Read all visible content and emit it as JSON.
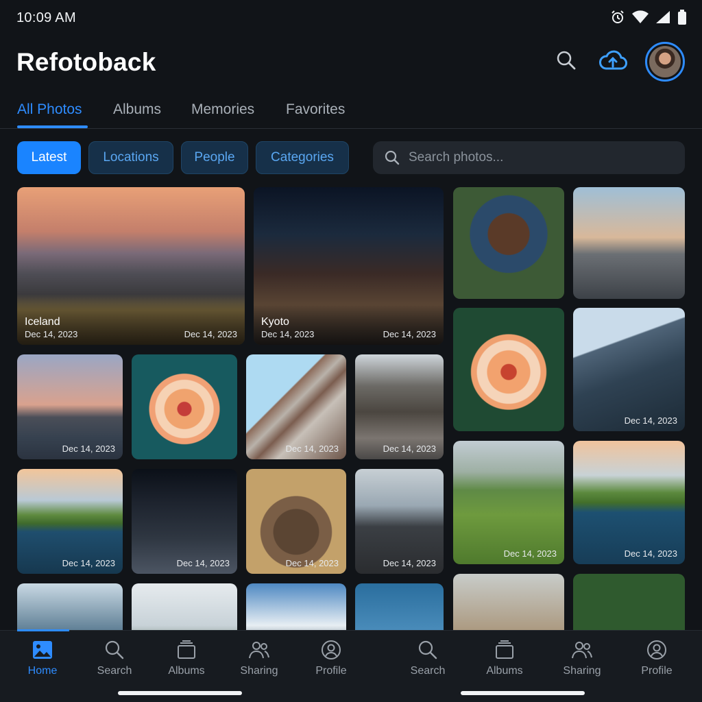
{
  "status_bar": {
    "time": "10:09 AM"
  },
  "header": {
    "title": "Refotoback"
  },
  "tabs": [
    {
      "label": "All Photos",
      "active": true
    },
    {
      "label": "Albums",
      "active": false
    },
    {
      "label": "Memories",
      "active": false
    },
    {
      "label": "Favorites",
      "active": false
    }
  ],
  "filters": [
    {
      "label": "Latest",
      "active": true
    },
    {
      "label": "Locations",
      "active": false
    },
    {
      "label": "People",
      "active": false
    },
    {
      "label": "Categories",
      "active": false
    }
  ],
  "search": {
    "placeholder": "Search photos..."
  },
  "photos": {
    "iceland": {
      "location": "Iceland",
      "date_left": "Dec 14, 2023",
      "date_right": "Dec 14, 2023"
    },
    "kyoto": {
      "location": "Kyoto",
      "date_left": "Dec 14, 2023",
      "date_right": "Dec 14, 2023"
    },
    "date": "Dec 14, 2023"
  },
  "bottom_nav": [
    {
      "label": "Home",
      "icon": "photo-icon",
      "active": true
    },
    {
      "label": "Search",
      "icon": "search-icon"
    },
    {
      "label": "Albums",
      "icon": "albums-icon"
    },
    {
      "label": "Sharing",
      "icon": "people-icon"
    },
    {
      "label": "Profile",
      "icon": "profile-icon"
    },
    {
      "label": "Search",
      "icon": "search-icon"
    },
    {
      "label": "Albums",
      "icon": "albums-icon"
    },
    {
      "label": "Sharing",
      "icon": "people-icon"
    },
    {
      "label": "Profile",
      "icon": "profile-icon"
    }
  ],
  "colors": {
    "accent": "#2e8cff",
    "background": "#111418",
    "chip_inactive": "#163049"
  }
}
